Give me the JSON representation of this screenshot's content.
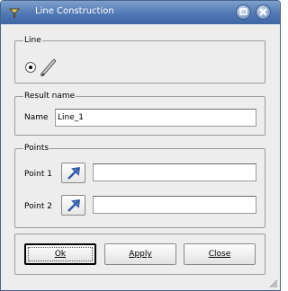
{
  "window": {
    "title": "Line Construction",
    "icons": {
      "app": "app-icon",
      "minimize": "minimize-icon",
      "close": "close-icon"
    }
  },
  "line_group": {
    "legend": "Line",
    "option_icon": "line-pen-icon",
    "option_selected": true
  },
  "result_group": {
    "legend": "Result name",
    "name_label": "Name",
    "name_value": "Line_1"
  },
  "points_group": {
    "legend": "Points",
    "point1_label": "Point 1",
    "point1_value": "",
    "point2_label": "Point 2",
    "point2_value": "",
    "select_icon": "selection-arrow-icon"
  },
  "buttons": {
    "ok": "Ok",
    "apply": "Apply",
    "close": "Close"
  },
  "colors": {
    "titlebar": "#4f78b4",
    "dialog_bg": "#ededed",
    "select_arrow": "#2e5aa8"
  }
}
